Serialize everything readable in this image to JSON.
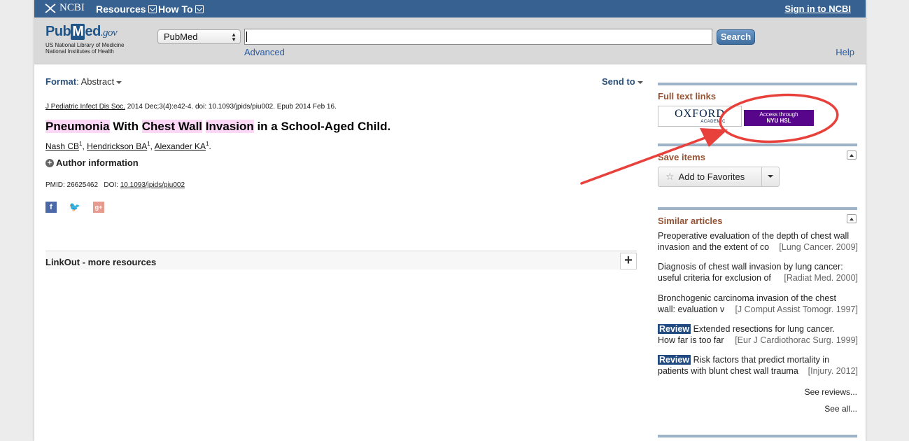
{
  "ncbi_bar": {
    "logo": "NCBI",
    "resources": "Resources",
    "how_to": "How To",
    "sign_in": "Sign in to NCBI"
  },
  "header": {
    "pubmed_left": "Pub",
    "pubmed_m": "M",
    "pubmed_right": "ed",
    "pubmed_gov": ".gov",
    "org_line1": "US National Library of Medicine",
    "org_line2": "National Institutes of Health",
    "db_select": "PubMed",
    "search_value": "",
    "search_button": "Search",
    "advanced": "Advanced",
    "help": "Help"
  },
  "toolbar": {
    "format_label": "Format",
    "format_value": ": Abstract",
    "send_to": "Send to"
  },
  "article": {
    "journal": "J Pediatric Infect Dis Soc.",
    "citation_rest": " 2014 Dec;3(4):e42-4. doi: 10.1093/jpids/piu002. Epub 2014 Feb 16.",
    "title_parts": {
      "p1": "Pneumonia",
      "p2": " With ",
      "p3": "Chest Wall",
      "p4": " ",
      "p5": "Invasion",
      "p6": " in a School-Aged Child."
    },
    "authors": [
      {
        "name": "Nash CB",
        "sup": "1"
      },
      {
        "name": "Hendrickson BA",
        "sup": "1"
      },
      {
        "name": "Alexander KA",
        "sup": "1"
      }
    ],
    "author_info": "Author information",
    "pmid_label": "PMID: 26625462",
    "doi_label": "DOI: ",
    "doi_value": "10.1093/jpids/piu002"
  },
  "social": {
    "facebook_glyph": "f",
    "twitter_glyph": "🐦",
    "google_glyph": "g+"
  },
  "linkout": {
    "label": "LinkOut - more resources",
    "expand": "+"
  },
  "right": {
    "full_text_heading": "Full text links",
    "oxford_name": "OXFORD",
    "oxford_sub": "ACADEMIC",
    "nyu_line1": "Access through",
    "nyu_line2": "NYU HSL",
    "save_heading": "Save items",
    "add_favorites": "Add to Favorites",
    "similar_heading": "Similar articles",
    "similar": [
      {
        "line1": "Preoperative evaluation of the depth of chest wall",
        "line2": "invasion and the extent of co",
        "source": "[Lung Cancer. 2009]",
        "review": ""
      },
      {
        "line1": "Diagnosis of chest wall invasion by lung cancer:",
        "line2": "useful criteria for exclusion of",
        "source": "[Radiat Med. 2000]",
        "review": ""
      },
      {
        "line1": "Bronchogenic carcinoma invasion of the chest",
        "line2": "wall: evaluation v",
        "source": "[J Comput Assist Tomogr. 1997]",
        "review": ""
      },
      {
        "line1": "Extended resections for lung cancer.",
        "line2": "How far is too far",
        "source": "[Eur J Cardiothorac Surg. 1999]",
        "review": "Review"
      },
      {
        "line1": "Risk factors that predict mortality in",
        "line2": "patients with blunt chest wall trauma",
        "source": "[Injury. 2012]",
        "review": "Review"
      }
    ],
    "see_reviews": "See reviews...",
    "see_all": "See all..."
  },
  "colors": {
    "ncbi_bar": "#366191",
    "highlight": "#fcd7f6",
    "heading_brown": "#955334",
    "nyu_purple": "#57068c",
    "annotation_red": "#e8403a"
  }
}
